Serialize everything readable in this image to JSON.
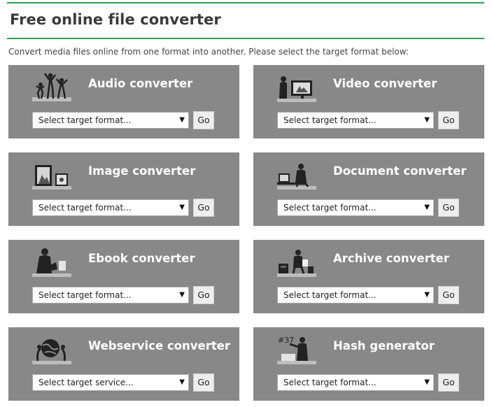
{
  "header": {
    "title": "Free online file converter",
    "intro": "Convert media files online from one format into another. Please select the target format below:"
  },
  "colors": {
    "accent_rule": "#2aa052",
    "card_background": "#888888",
    "card_title": "#ffffff"
  },
  "converters": [
    {
      "title": "Audio converter",
      "select": "Select target format...",
      "go": "Go",
      "icon": "audio-people-icon"
    },
    {
      "title": "Video converter",
      "select": "Select target format...",
      "go": "Go",
      "icon": "video-screen-icon"
    },
    {
      "title": "Image converter",
      "select": "Select target format...",
      "go": "Go",
      "icon": "image-frames-icon"
    },
    {
      "title": "Document converter",
      "select": "Select target format...",
      "go": "Go",
      "icon": "document-desk-icon"
    },
    {
      "title": "Ebook converter",
      "select": "Select target format...",
      "go": "Go",
      "icon": "ebook-reader-icon"
    },
    {
      "title": "Archive converter",
      "select": "Select target format...",
      "go": "Go",
      "icon": "archive-boxes-icon"
    },
    {
      "title": "Webservice converter",
      "select": "Select target service...",
      "go": "Go",
      "icon": "webservice-globe-icon"
    },
    {
      "title": "Hash generator",
      "select": "Select target format...",
      "go": "Go",
      "icon": "hash-writer-icon"
    }
  ]
}
